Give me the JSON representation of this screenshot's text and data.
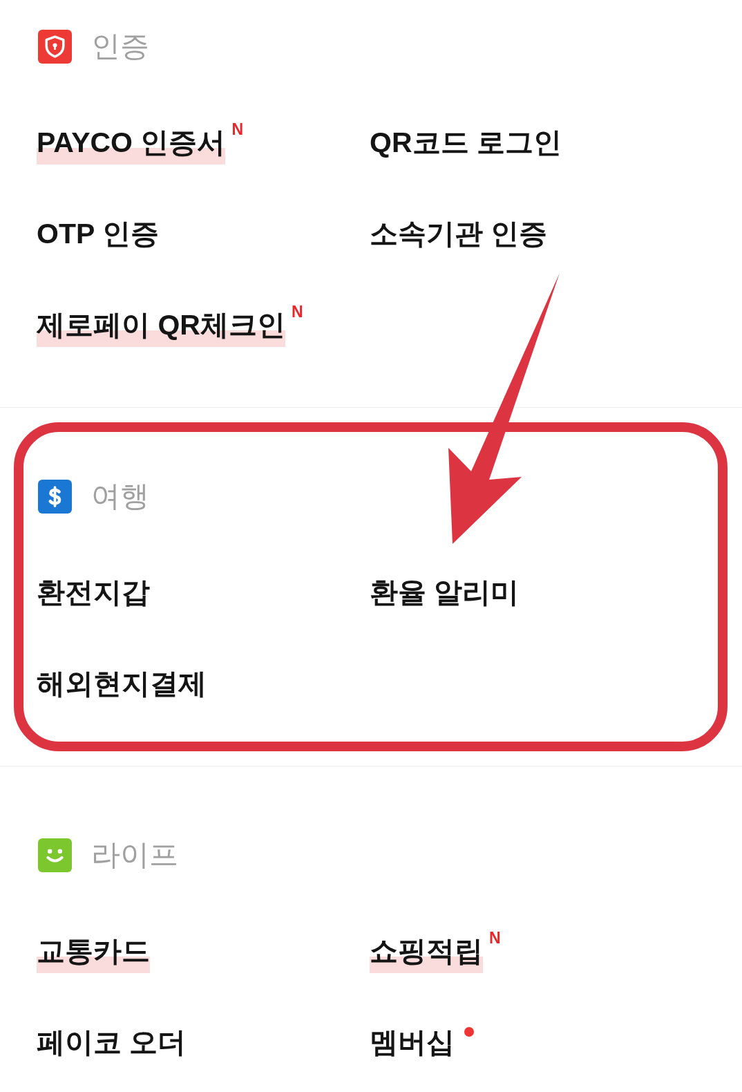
{
  "sections": [
    {
      "title": "인증",
      "color": "#ee3a35",
      "highlighted": false,
      "items": [
        {
          "label": "PAYCO 인증서",
          "underlined": true,
          "badge": "N",
          "dot": false
        },
        {
          "label": "QR코드 로그인",
          "underlined": false,
          "dot": false
        },
        {
          "label": "OTP 인증",
          "underlined": false,
          "dot": false
        },
        {
          "label": "소속기관 인증",
          "underlined": false,
          "dot": false
        },
        {
          "label": "제로페이 QR체크인",
          "underlined": true,
          "badge": "N",
          "dot": false
        }
      ]
    },
    {
      "title": "여행",
      "color": "#1a78d4",
      "highlighted": true,
      "items": [
        {
          "label": "환전지갑",
          "underlined": false,
          "dot": false
        },
        {
          "label": "환율 알리미",
          "underlined": false,
          "dot": false
        },
        {
          "label": "해외현지결제",
          "underlined": false,
          "dot": false
        }
      ]
    },
    {
      "title": "라이프",
      "color": "#7cc72e",
      "highlighted": false,
      "items": [
        {
          "label": "교통카드",
          "underlined": true,
          "dot": false
        },
        {
          "label": "쇼핑적립",
          "underlined": true,
          "badge": "N",
          "dot": false
        },
        {
          "label": "페이코 오더",
          "underlined": false,
          "dot": false
        },
        {
          "label": "멤버십",
          "underlined": false,
          "dot": true
        }
      ]
    }
  ]
}
